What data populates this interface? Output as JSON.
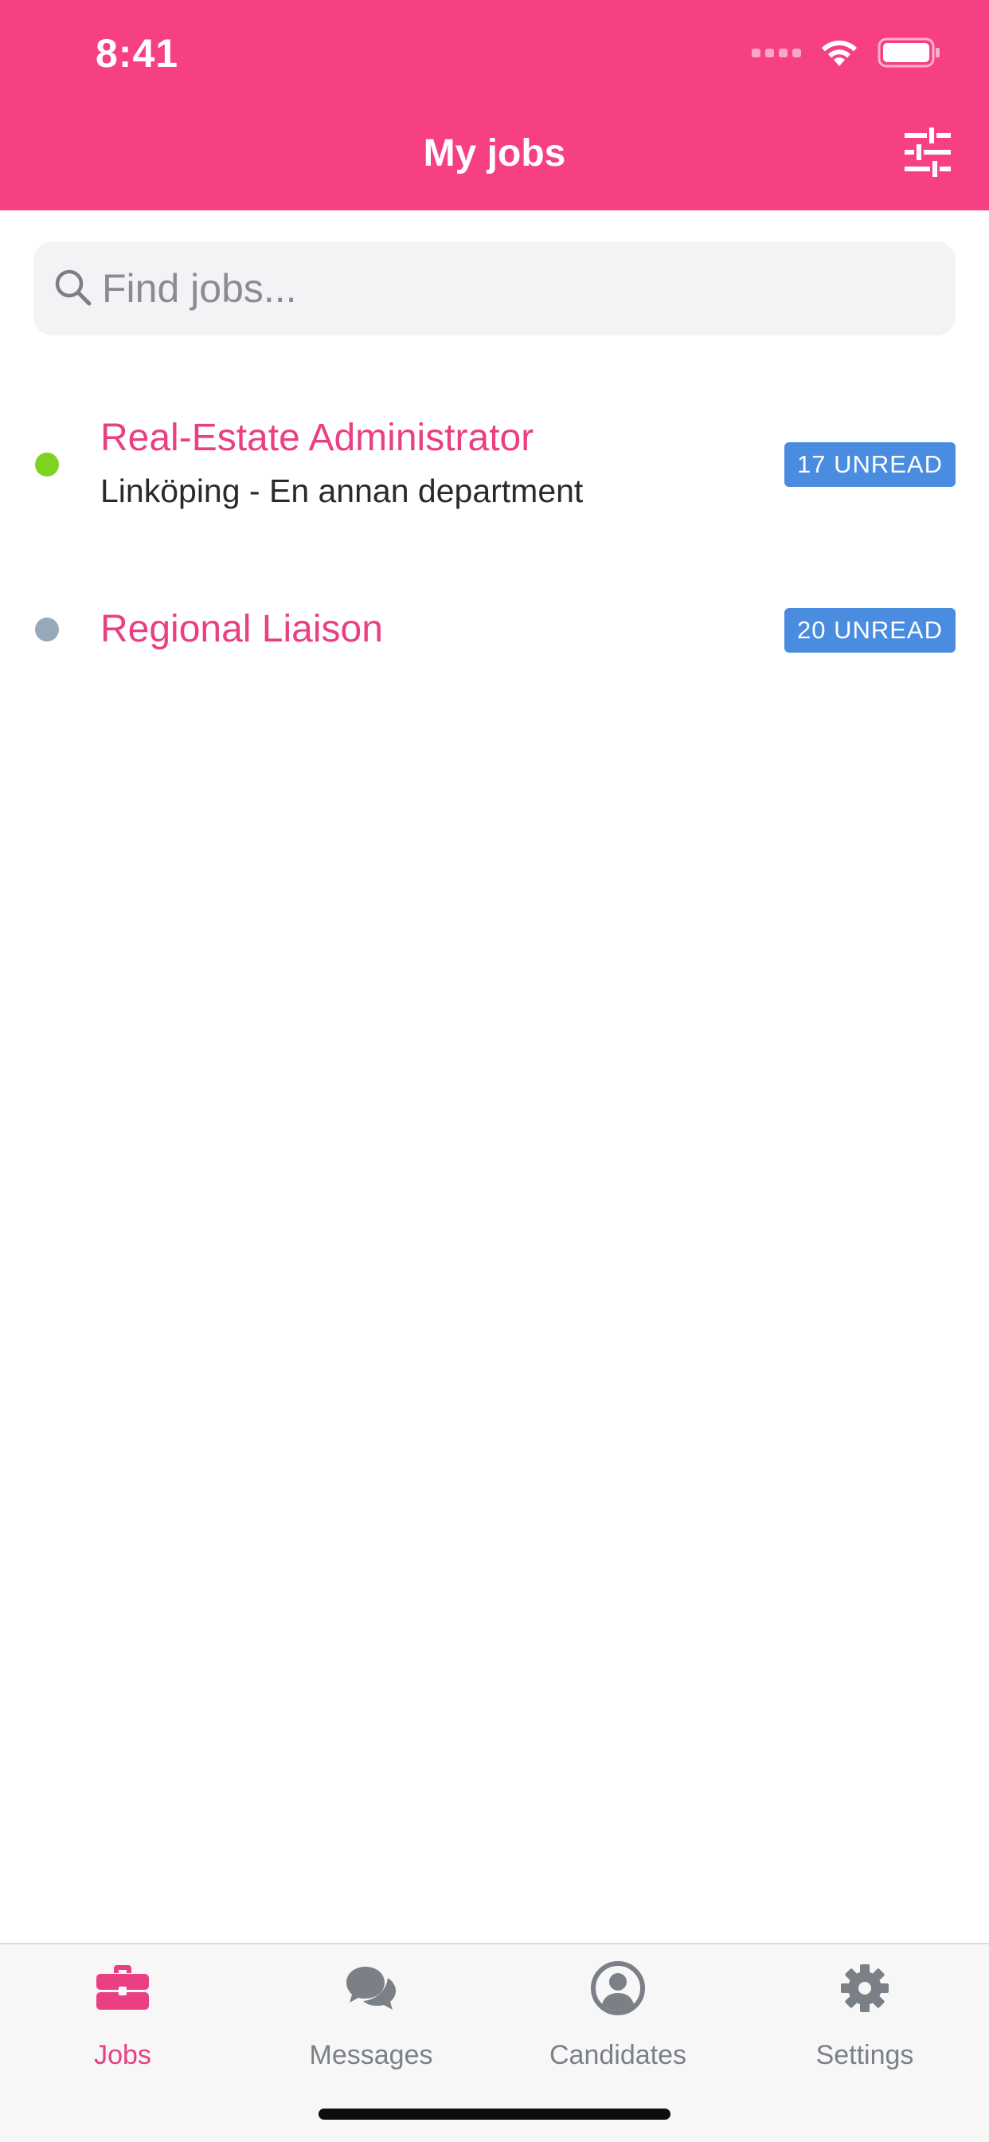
{
  "status_bar": {
    "time": "8:41"
  },
  "header": {
    "title": "My jobs",
    "filter_icon": "sliders-icon"
  },
  "search": {
    "placeholder": "Find jobs...",
    "value": ""
  },
  "jobs": [
    {
      "title": "Real-Estate Administrator",
      "subtitle": "Linköping - En annan department",
      "badge": "17 UNREAD",
      "status_color": "#7ed321"
    },
    {
      "title": "Regional Liaison",
      "subtitle": "",
      "badge": "20 UNREAD",
      "status_color": "#97a9b8"
    }
  ],
  "tabs": [
    {
      "label": "Jobs",
      "icon": "briefcase-icon",
      "active": true
    },
    {
      "label": "Messages",
      "icon": "chat-bubbles-icon",
      "active": false
    },
    {
      "label": "Candidates",
      "icon": "user-circle-icon",
      "active": false
    },
    {
      "label": "Settings",
      "icon": "gear-icon",
      "active": false
    }
  ],
  "colors": {
    "accent": "#f73f84",
    "title_pink": "#ea3f82",
    "badge_blue": "#4a8cdf",
    "tab_inactive": "#7b8087"
  }
}
